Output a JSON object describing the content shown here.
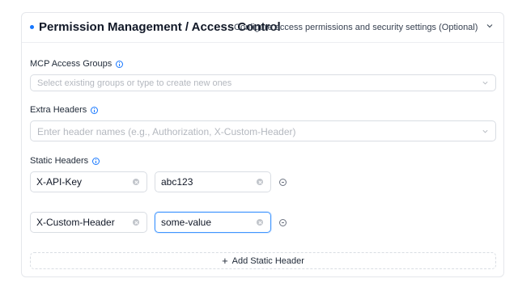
{
  "section": {
    "title": "Permission Management / Access Control",
    "subtitle": "Configure access permissions and security settings (Optional)",
    "accent_color": "#1677ff"
  },
  "access_groups": {
    "label": "MCP Access Groups",
    "placeholder": "Select existing groups or type to create new ones"
  },
  "extra_headers": {
    "label": "Extra Headers",
    "placeholder": "Enter header names (e.g., Authorization, X-Custom-Header)"
  },
  "static_headers": {
    "label": "Static Headers",
    "rows": [
      {
        "key": "X-API-Key",
        "value": "abc123"
      },
      {
        "key": "X-Custom-Header",
        "value": "some-value"
      }
    ],
    "add_label": "Add Static Header"
  }
}
